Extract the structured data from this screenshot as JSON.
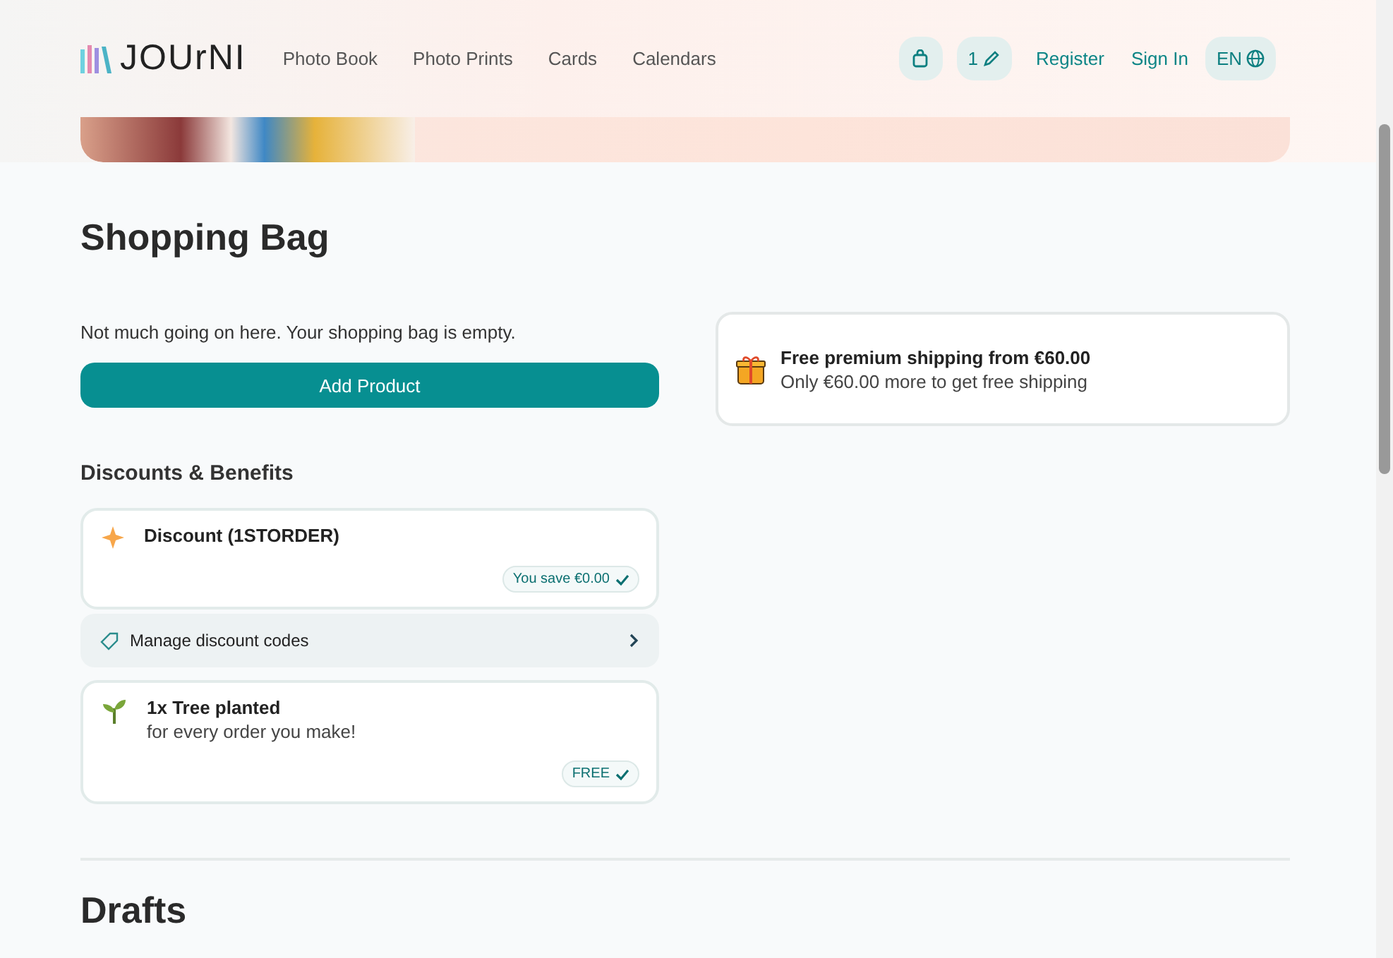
{
  "header": {
    "logo": "JOUrNI",
    "nav": [
      "Photo Book",
      "Photo Prints",
      "Cards",
      "Calendars"
    ],
    "drafts_count": "1",
    "links": [
      "Register",
      "Sign In"
    ],
    "language": "EN"
  },
  "page_title": "Shopping Bag",
  "empty_message": "Not much going on here. Your shopping bag is empty.",
  "add_button": "Add Product",
  "shipping": {
    "title": "Free premium shipping from €60.00",
    "subtitle": "Only €60.00 more to get free shipping"
  },
  "discounts": {
    "heading": "Discounts & Benefits",
    "discount": {
      "title": "Discount (1STORDER)",
      "badge": "You save €0.00"
    },
    "manage": "Manage discount codes",
    "tree": {
      "title": "1x Tree planted",
      "subtitle": "for every order you make!",
      "badge": "FREE"
    }
  },
  "drafts_title": "Drafts"
}
